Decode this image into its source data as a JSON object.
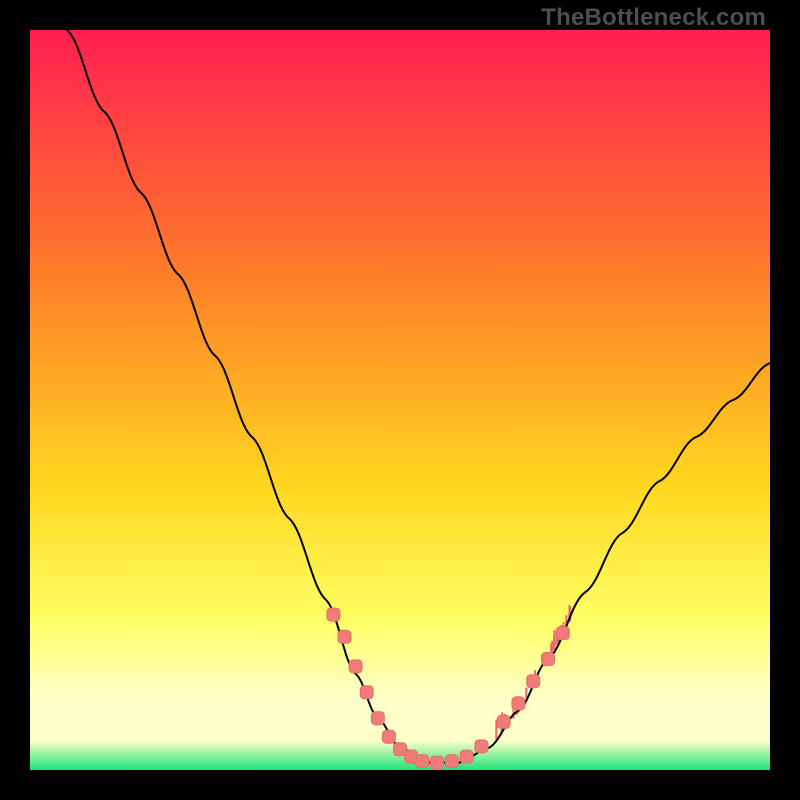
{
  "watermark": "TheBottleneck.com",
  "colors": {
    "background": "#000000",
    "gradient_top": "#ff1f50",
    "gradient_upper_mid": "#ff7a2a",
    "gradient_mid": "#ffd81f",
    "gradient_lower_mid": "#ffff66",
    "gradient_pale": "#ffffc8",
    "gradient_green": "#20e47a",
    "curve_stroke": "#000000",
    "marker_fill": "#ef7c79",
    "marker_stroke": "#e86b67",
    "tick_fill": "#e86b67"
  },
  "chart_data": {
    "type": "line",
    "title": "",
    "xlabel": "",
    "ylabel": "",
    "xlim": [
      0,
      100
    ],
    "ylim": [
      0,
      100
    ],
    "curve": [
      {
        "x": 5.0,
        "y": 100.0
      },
      {
        "x": 10.0,
        "y": 89.0
      },
      {
        "x": 15.0,
        "y": 78.0
      },
      {
        "x": 20.0,
        "y": 67.0
      },
      {
        "x": 25.0,
        "y": 56.0
      },
      {
        "x": 30.0,
        "y": 45.0
      },
      {
        "x": 35.0,
        "y": 34.0
      },
      {
        "x": 40.0,
        "y": 23.0
      },
      {
        "x": 44.0,
        "y": 13.0
      },
      {
        "x": 47.0,
        "y": 7.0
      },
      {
        "x": 50.0,
        "y": 3.0
      },
      {
        "x": 54.0,
        "y": 1.0
      },
      {
        "x": 58.0,
        "y": 1.0
      },
      {
        "x": 62.0,
        "y": 3.0
      },
      {
        "x": 66.0,
        "y": 8.0
      },
      {
        "x": 70.0,
        "y": 15.0
      },
      {
        "x": 75.0,
        "y": 24.0
      },
      {
        "x": 80.0,
        "y": 32.0
      },
      {
        "x": 85.0,
        "y": 39.0
      },
      {
        "x": 90.0,
        "y": 45.0
      },
      {
        "x": 95.0,
        "y": 50.0
      },
      {
        "x": 100.0,
        "y": 55.0
      }
    ],
    "markers": [
      {
        "x": 41.0,
        "y": 21.0
      },
      {
        "x": 42.5,
        "y": 18.0
      },
      {
        "x": 44.0,
        "y": 14.0
      },
      {
        "x": 45.5,
        "y": 10.5
      },
      {
        "x": 47.0,
        "y": 7.0
      },
      {
        "x": 48.5,
        "y": 4.5
      },
      {
        "x": 50.0,
        "y": 2.8
      },
      {
        "x": 51.5,
        "y": 1.8
      },
      {
        "x": 53.0,
        "y": 1.2
      },
      {
        "x": 55.0,
        "y": 1.0
      },
      {
        "x": 57.0,
        "y": 1.2
      },
      {
        "x": 59.0,
        "y": 1.8
      },
      {
        "x": 61.0,
        "y": 3.2
      },
      {
        "x": 64.0,
        "y": 6.5
      },
      {
        "x": 66.0,
        "y": 9.0
      },
      {
        "x": 68.0,
        "y": 12.0
      },
      {
        "x": 70.0,
        "y": 15.0
      },
      {
        "x": 72.0,
        "y": 18.5
      }
    ],
    "noise_ticks_x_range": [
      63,
      74
    ],
    "noise_ticks_count": 28
  }
}
